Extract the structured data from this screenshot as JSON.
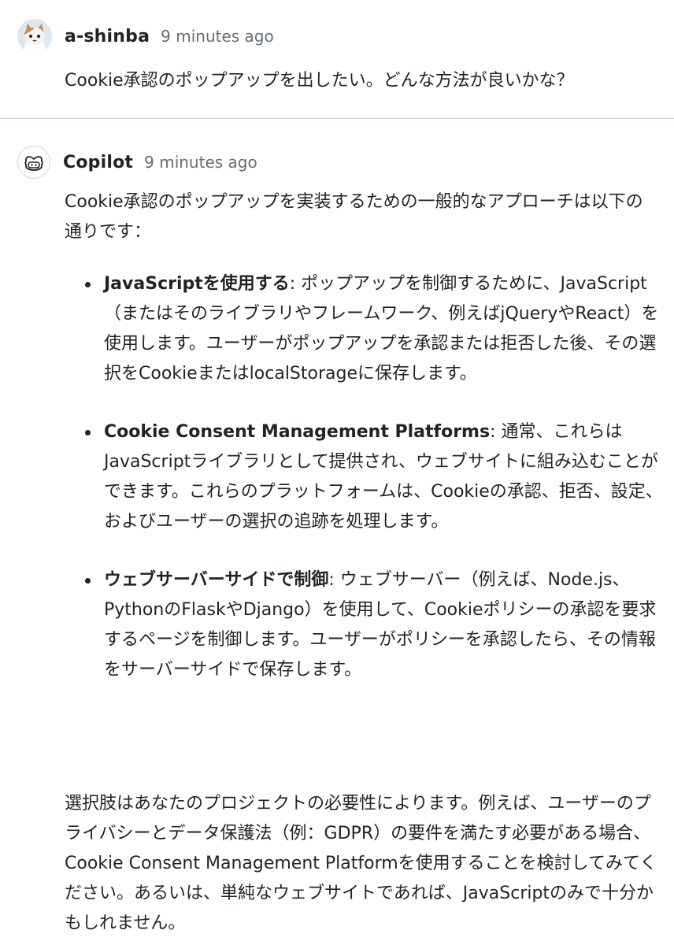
{
  "colors": {
    "text": "#1f2328",
    "muted": "#656d76",
    "border": "#d0d7de"
  },
  "user_message": {
    "author": "a-shinba",
    "time": "9 minutes ago",
    "avatar_icon": "cat-avatar-icon",
    "body": "Cookie承認のポップアップを出したい。どんな方法が良いかな？"
  },
  "copilot_message": {
    "author": "Copilot",
    "time": "9 minutes ago",
    "avatar_icon": "copilot-icon",
    "intro": "Cookie承認のポップアップを実装するための一般的なアプローチは以下の通りです：",
    "bullets": [
      {
        "title": "JavaScriptを使用する",
        "text": ": ポップアップを制御するために、JavaScript（またはそのライブラリやフレームワーク、例えばjQueryやReact）を使用します。ユーザーがポップアップを承認または拒否した後、その選択をCookieまたはlocalStorageに保存します。"
      },
      {
        "title": "Cookie Consent Management Platforms",
        "text": ": 通常、これらはJavaScriptライブラリとして提供され、ウェブサイトに組み込むことができます。これらのプラットフォームは、Cookieの承認、拒否、設定、およびユーザーの選択の追跡を処理します。"
      },
      {
        "title": "ウェブサーバーサイドで制御",
        "text": ": ウェブサーバー（例えば、Node.js、PythonのFlaskやDjango）を使用して、Cookieポリシーの承認を要求するページを制御します。ユーザーがポリシーを承認したら、その情報をサーバーサイドで保存します。"
      }
    ],
    "closing": "選択肢はあなたのプロジェクトの必要性によります。例えば、ユーザーのプライバシーとデータ保護法（例：GDPR）の要件を満たす必要がある場合、Cookie Consent Management Platformを使用することを検討してみてください。あるいは、単純なウェブサイトであれば、JavaScriptのみで十分かもしれません。"
  }
}
